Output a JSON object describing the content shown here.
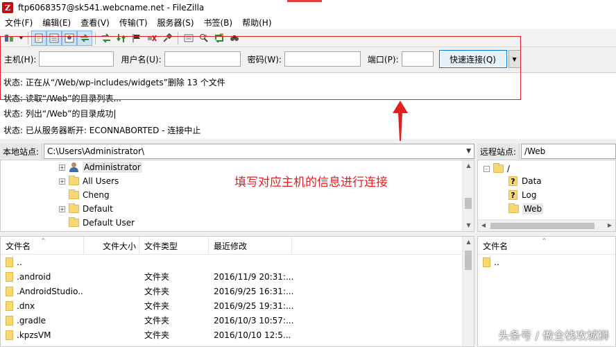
{
  "window": {
    "title": "ftp6068357@sk541.webcname.net - FileZilla",
    "app_icon": "Z"
  },
  "menu": [
    "文件(F)",
    "编辑(E)",
    "查看(V)",
    "传输(T)",
    "服务器(S)",
    "书签(B)",
    "帮助(H)"
  ],
  "toolbar": {
    "icons": [
      "site-manager-icon",
      "site-manager-dropdown-icon",
      "toggle-log-icon",
      "toggle-local-tree-icon",
      "toggle-remote-tree-icon",
      "toggle-queue-icon",
      "refresh-icon",
      "process-queue-icon",
      "stop-icon",
      "disconnect-icon",
      "reconnect-icon",
      "filter-icon",
      "compare-icon",
      "sync-browse-icon",
      "search-icon"
    ]
  },
  "quickconnect": {
    "host_label": "主机(H):",
    "host_value": "",
    "user_label": "用户名(U):",
    "user_value": "",
    "pass_label": "密码(W):",
    "pass_value": "",
    "port_label": "端口(P):",
    "port_value": "",
    "connect_label": "快速连接(Q)"
  },
  "log": [
    {
      "prefix": "状态:",
      "text": "正在从“/Web/wp-includes/widgets”删除 13 个文件"
    },
    {
      "prefix": "状态:",
      "text": "读取“/Web”的目录列表..."
    },
    {
      "prefix": "状态:",
      "text": "列出“/Web”的目录成功"
    },
    {
      "prefix": "状态:",
      "text": "已从服务器断开: ECONNABORTED - 连接中止"
    }
  ],
  "annotation": "填写对应主机的信息进行连接",
  "local": {
    "site_label": "本地站点:",
    "path": "C:\\Users\\Administrator\\",
    "tree": [
      {
        "name": "Administrator",
        "expander": "+",
        "icon": "user-icon"
      },
      {
        "name": "All Users",
        "expander": "+",
        "icon": "folder-icon"
      },
      {
        "name": "Cheng",
        "expander": "",
        "icon": "folder-icon"
      },
      {
        "name": "Default",
        "expander": "+",
        "icon": "folder-icon"
      },
      {
        "name": "Default User",
        "expander": "",
        "icon": "folder-icon"
      }
    ],
    "columns": [
      "文件名",
      "文件大小",
      "文件类型",
      "最近修改"
    ],
    "files": [
      {
        "name": "..",
        "size": "",
        "type": "",
        "modified": ""
      },
      {
        "name": ".android",
        "size": "",
        "type": "文件夹",
        "modified": "2016/11/9 20:31:..."
      },
      {
        "name": ".AndroidStudio...",
        "size": "",
        "type": "文件夹",
        "modified": "2016/9/25 16:31:..."
      },
      {
        "name": ".dnx",
        "size": "",
        "type": "文件夹",
        "modified": "2016/9/25 19:31:..."
      },
      {
        "name": ".gradle",
        "size": "",
        "type": "文件夹",
        "modified": "2016/10/3 10:57:..."
      },
      {
        "name": ".kpzsVM",
        "size": "",
        "type": "文件夹",
        "modified": "2016/10/10 12:5..."
      }
    ]
  },
  "remote": {
    "site_label": "远程站点:",
    "path": "/Web",
    "tree": [
      {
        "name": "/",
        "expander": "-",
        "icon": "folder-icon"
      },
      {
        "name": "Data",
        "expander": "",
        "icon": "unknown-folder-icon"
      },
      {
        "name": "Log",
        "expander": "",
        "icon": "unknown-folder-icon"
      },
      {
        "name": "Web",
        "expander": "",
        "icon": "folder-icon"
      }
    ],
    "columns": [
      "文件名"
    ],
    "files": [
      {
        "name": ".."
      }
    ]
  },
  "watermark": "头条号 / 做全栈攻城狮",
  "colors": {
    "annotation_red": "#e02020",
    "selection_blue": "#cce4f7",
    "folder_yellow": "#f8d775"
  }
}
